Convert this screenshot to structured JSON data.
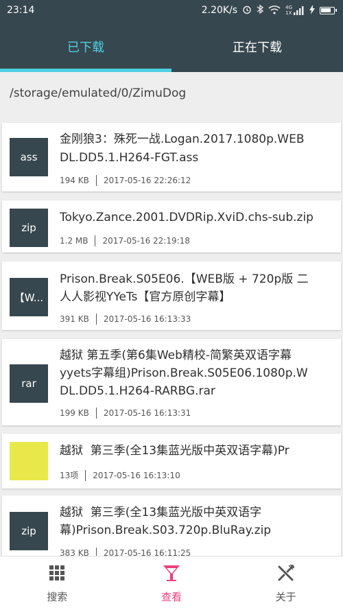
{
  "status_bar": {
    "time": "23:14",
    "speed": "2.20K/s",
    "icons": [
      "alarm-icon",
      "bluetooth-icon",
      "wifi-icon",
      "signal-icon",
      "charging-icon",
      "battery-icon"
    ],
    "network_label_top": "4G",
    "network_label_bottom": "1X"
  },
  "tabs": [
    {
      "label": "已下载",
      "active": true
    },
    {
      "label": "正在下载",
      "active": false
    }
  ],
  "path": "/storage/emulated/0/ZimuDog",
  "files": [
    {
      "thumb": "ass",
      "line1": "金刚狼3：殊死一战.Logan.2017.1080p.WEB",
      "line2": "DL.DD5.1.H264-FGT.ass",
      "size": "194 KB",
      "date": "2017-05-16 22:26:12"
    },
    {
      "thumb": "zip",
      "line1": "Tokyo.Zance.2001.DVDRip.XviD.chs-sub.zip",
      "line2": "",
      "size": "1.2 MB",
      "date": "2017-05-16 22:19:18"
    },
    {
      "thumb": "【W...",
      "line1": "Prison.Break.S05E06.【WEB版 + 720p版 二",
      "line2": "人人影视YYeTs【官方原创字幕】",
      "size": "391 KB",
      "date": "2017-05-16 16:13:33"
    },
    {
      "thumb": "rar",
      "line1": "越狱 第五季(第6集Web精校-简繁英双语字幕",
      "line2": "yyets字幕组)Prison.Break.S05E06.1080p.W",
      "line3": "DL.DD5.1.H264-RARBG.rar",
      "size": "199 KB",
      "date": "2017-05-16 16:13:31"
    },
    {
      "thumb": "",
      "line1": "越狱  第三季(全13集蓝光版中英双语字幕)Pr",
      "line2": "",
      "size": "13项",
      "date": "2017-05-16 16:13:10"
    },
    {
      "thumb": "zip",
      "line1": "越狱  第三季(全13集蓝光版中英双语字",
      "line2": "幕)Prison.Break.S03.720p.BluRay.zip",
      "size": "383 KB",
      "date": "2017-05-16 16:11:25"
    }
  ],
  "bottom_nav": [
    {
      "label": "搜索",
      "icon": "grid-icon",
      "active": false
    },
    {
      "label": "查看",
      "icon": "cocktail-glass-icon",
      "active": true
    },
    {
      "label": "关于",
      "icon": "fork-knife-icon",
      "active": false
    }
  ],
  "colors": {
    "primary": "#37474f",
    "accent": "#4dd0e1",
    "active_nav": "#ec407a",
    "folder": "#e8e84a"
  }
}
